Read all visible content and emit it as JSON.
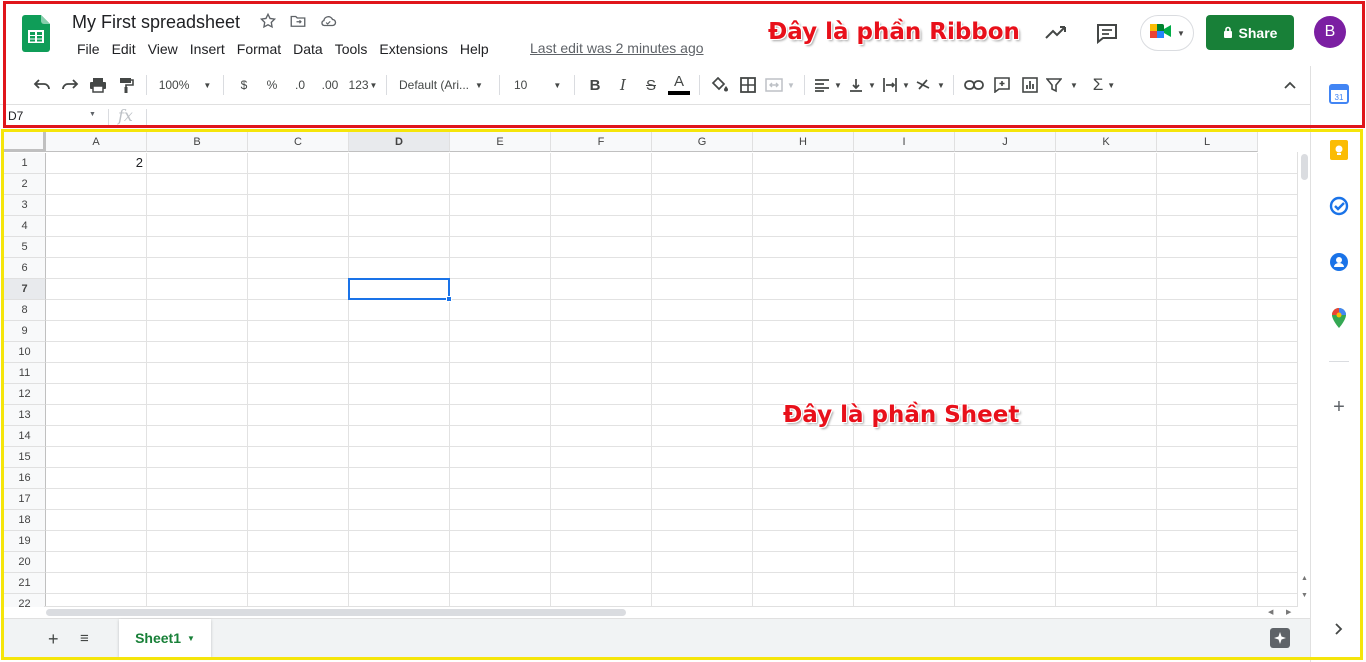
{
  "doc": {
    "title": "My First spreadsheet",
    "last_edit": "Last edit was 2 minutes ago"
  },
  "menu": [
    "File",
    "Edit",
    "View",
    "Insert",
    "Format",
    "Data",
    "Tools",
    "Extensions",
    "Help"
  ],
  "header": {
    "share_label": "Share",
    "avatar_initial": "B"
  },
  "annotations": {
    "ribbon": "Đây là phần Ribbon",
    "sheet": "Đây là phần Sheet"
  },
  "toolbar": {
    "zoom": "100%",
    "currency": "$",
    "percent": "%",
    "dec_decrease": ".0",
    "dec_increase": ".00",
    "more_formats": "123",
    "font": "Default (Ari...",
    "font_size": "10",
    "bold": "B",
    "italic": "I",
    "strike": "S",
    "text_color": "A"
  },
  "formula_bar": {
    "name_box": "D7",
    "fx": "fx",
    "value": ""
  },
  "grid": {
    "columns": [
      "A",
      "B",
      "C",
      "D",
      "E",
      "F",
      "G",
      "H",
      "I",
      "J",
      "K",
      "L"
    ],
    "rows": [
      "1",
      "2",
      "3",
      "4",
      "5",
      "6",
      "7",
      "8",
      "9",
      "10",
      "11",
      "12",
      "13",
      "14",
      "15",
      "16",
      "17",
      "18",
      "19",
      "20",
      "21",
      "22"
    ],
    "selected_cell": "D7",
    "cells": {
      "A1": "2"
    }
  },
  "sheets": [
    {
      "name": "Sheet1",
      "active": true
    }
  ],
  "side_panel": [
    "calendar-icon",
    "keep-icon",
    "tasks-icon",
    "contacts-icon",
    "maps-icon",
    "add-icon",
    "expand-icon"
  ],
  "colors": {
    "share": "#188038",
    "selection": "#1a73e8",
    "avatar": "#7b1fa2",
    "ribbon_frame": "#e0151b",
    "sheet_frame": "#f5e50a"
  }
}
